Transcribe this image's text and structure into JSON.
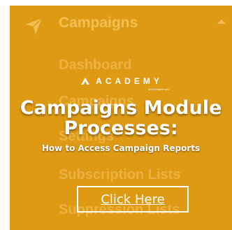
{
  "colors": {
    "panel": "#df9a14",
    "faded_text": "#ebb241",
    "overlay_text": "#ffffff"
  },
  "menu": {
    "icon": "paper-plane-icon",
    "title": "Campaigns",
    "chevron": "chevron-up-icon",
    "items": [
      {
        "label": "Dashboard"
      },
      {
        "label": "Campaigns"
      },
      {
        "label": "Settings"
      },
      {
        "label": "Subscription Lists"
      },
      {
        "label": "Suppression Lists"
      }
    ]
  },
  "overlay": {
    "brand_name": "ACADEMY",
    "brand_tagline": "art to inspire you",
    "headline_line1": "Campaigns Module",
    "headline_line2": "Processes:",
    "subheadline": "How to Access Campaign Reports",
    "cta_label": "Click Here"
  }
}
